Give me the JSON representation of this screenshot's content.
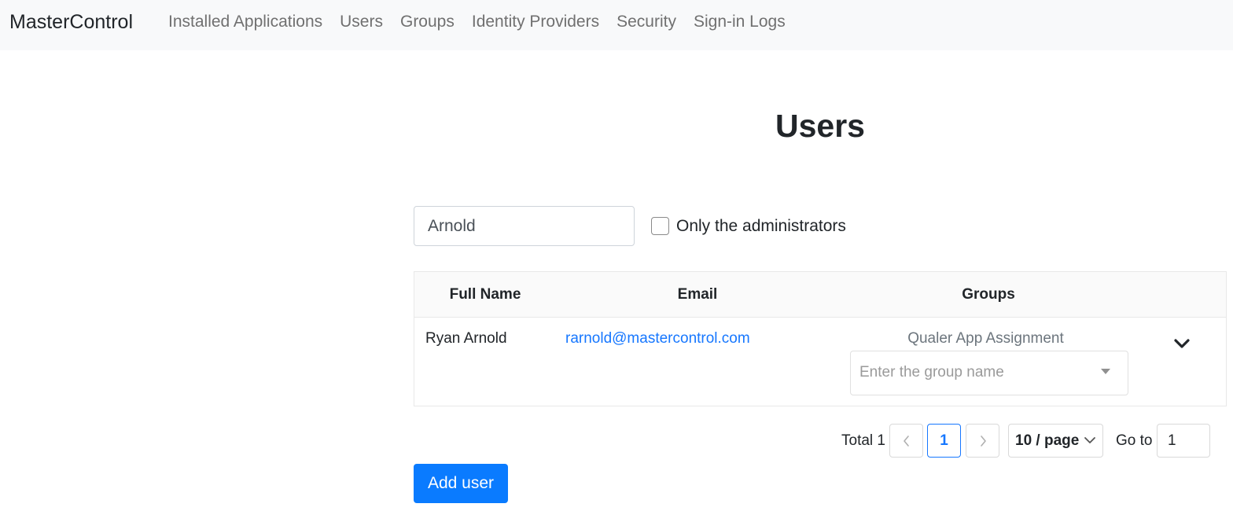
{
  "app": {
    "brand": "MasterControl"
  },
  "nav": {
    "items": [
      {
        "label": "Installed Applications"
      },
      {
        "label": "Users"
      },
      {
        "label": "Groups"
      },
      {
        "label": "Identity Providers"
      },
      {
        "label": "Security"
      },
      {
        "label": "Sign-in Logs"
      }
    ]
  },
  "page": {
    "title": "Users"
  },
  "filters": {
    "search_value": "Arnold",
    "admin_only_label": "Only the administrators",
    "admin_only_checked": false
  },
  "table": {
    "columns": [
      "Full Name",
      "Email",
      "Groups"
    ],
    "rows": [
      {
        "full_name": "Ryan Arnold",
        "email": "rarnold@mastercontrol.com",
        "group": "Qualer App Assignment",
        "group_placeholder": "Enter the group name",
        "expand_icon": "chevron-down-icon"
      }
    ]
  },
  "pagination": {
    "total_label": "Total 1",
    "current_page": "1",
    "page_size": "10 / page",
    "goto_label": "Go to",
    "goto_value": "1"
  },
  "actions": {
    "add_user_label": "Add user"
  },
  "colors": {
    "primary": "#0a7bff",
    "link": "#1677ff",
    "navbar_bg": "#f8f9fa"
  }
}
